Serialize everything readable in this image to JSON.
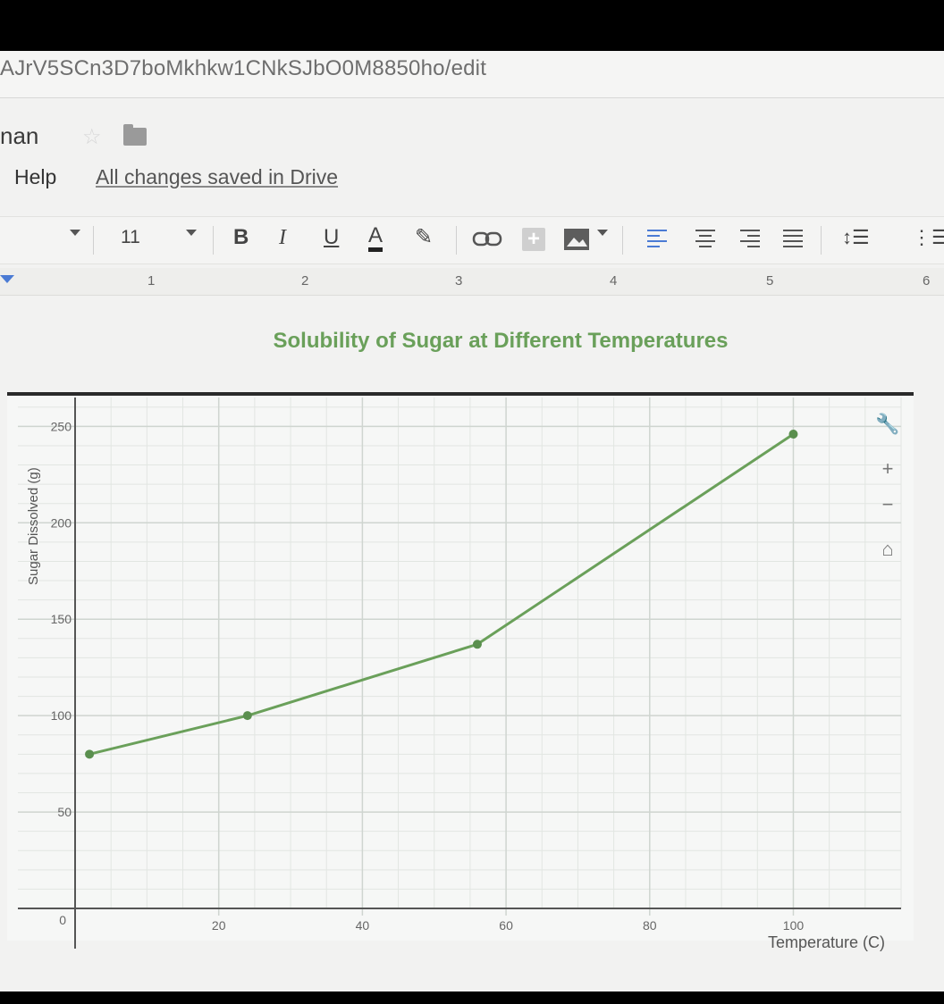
{
  "browser": {
    "url": "AJrV5SCn3D7boMkhkw1CNkSJbO0M8850ho/edit"
  },
  "doc": {
    "title_fragment": "nan",
    "menu_help": "Help",
    "save_status": "All changes saved in Drive"
  },
  "toolbar": {
    "font_size": "11",
    "bold": "B",
    "italic": "I",
    "underline": "U",
    "text_color": "A",
    "icons": [
      "pencil-highlight-icon",
      "link-icon",
      "insert-comment-icon",
      "insert-image-icon",
      "align-left-icon",
      "align-center-icon",
      "align-right-icon",
      "align-justify-icon",
      "line-spacing-icon",
      "numbered-list-icon"
    ]
  },
  "ruler": {
    "labels": [
      "1",
      "2",
      "3",
      "4",
      "5",
      "6"
    ]
  },
  "chart_tools": {
    "icons": [
      "wrench-icon",
      "zoom-in-icon",
      "zoom-out-icon",
      "home-icon"
    ],
    "zoom_in": "+",
    "zoom_out": "−"
  },
  "colors": {
    "series": "#6aa05a",
    "title": "#6aa05a",
    "grid": "#cfd5d0",
    "axis": "#555555",
    "point": "#5a8f4e"
  },
  "chart_data": {
    "type": "line",
    "title": "Solubility of Sugar at Different Temperatures",
    "xlabel": "Temperature (C)",
    "ylabel": "Sugar Dissolved (g)",
    "x_ticks": [
      0,
      20,
      40,
      60,
      80,
      100
    ],
    "y_ticks": [
      50,
      100,
      150,
      200,
      250
    ],
    "xlim": [
      0,
      115
    ],
    "ylim": [
      0,
      265
    ],
    "grid": true,
    "series": [
      {
        "x": [
          2,
          24,
          56,
          100
        ],
        "y": [
          80,
          100,
          137,
          246
        ]
      }
    ]
  }
}
